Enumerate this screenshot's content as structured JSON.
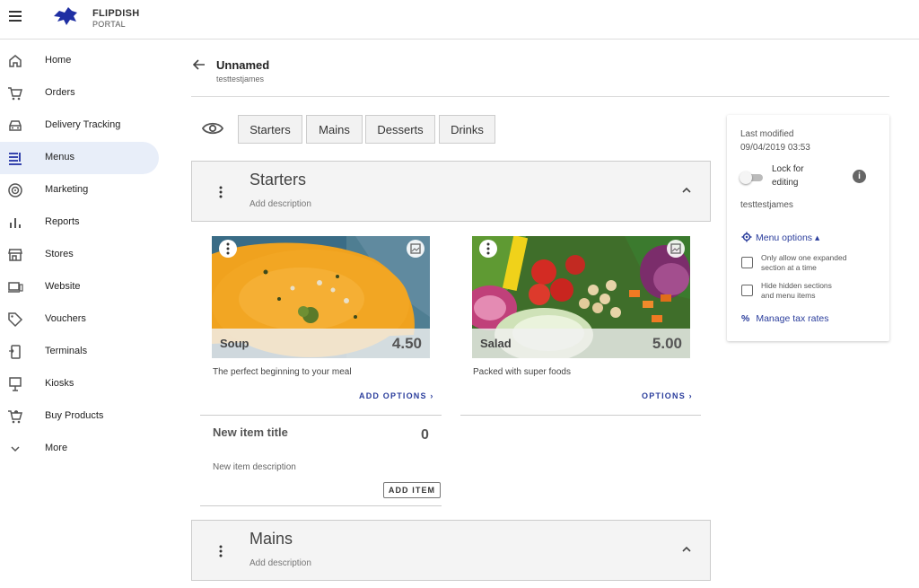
{
  "header": {
    "brand": "FLIPDISH",
    "brand_sub": "PORTAL"
  },
  "sidebar": {
    "items": [
      {
        "label": "Home",
        "icon": "home-icon"
      },
      {
        "label": "Orders",
        "icon": "cart-icon"
      },
      {
        "label": "Delivery Tracking",
        "icon": "car-icon"
      },
      {
        "label": "Menus",
        "icon": "menu-book-icon"
      },
      {
        "label": "Marketing",
        "icon": "target-icon"
      },
      {
        "label": "Reports",
        "icon": "bar-chart-icon"
      },
      {
        "label": "Stores",
        "icon": "store-icon"
      },
      {
        "label": "Website",
        "icon": "laptop-icon"
      },
      {
        "label": "Vouchers",
        "icon": "tag-icon"
      },
      {
        "label": "Terminals",
        "icon": "terminal-icon"
      },
      {
        "label": "Kiosks",
        "icon": "kiosk-icon"
      },
      {
        "label": "Buy Products",
        "icon": "shopping-cart-icon"
      },
      {
        "label": "More",
        "icon": "chevron-down-icon"
      }
    ],
    "active_index": 3
  },
  "page": {
    "title": "Unnamed",
    "subtitle": "testtestjames"
  },
  "tabs": [
    "Starters",
    "Mains",
    "Desserts",
    "Drinks"
  ],
  "sections": [
    {
      "title": "Starters",
      "description": "Add description"
    },
    {
      "title": "Mains",
      "description": "Add description"
    }
  ],
  "items": [
    {
      "name": "Soup",
      "price": "4.50",
      "description": "The perfect beginning to your meal",
      "action": "ADD OPTIONS"
    },
    {
      "name": "Salad",
      "price": "5.00",
      "description": "Packed with super foods",
      "action": "OPTIONS"
    }
  ],
  "new_item": {
    "title": "New item title",
    "price": "0",
    "description": "New item description",
    "button": "ADD ITEM"
  },
  "panel": {
    "last_modified_label": "Last modified",
    "last_modified_value": "09/04/2019 03:53",
    "lock_label_1": "Lock for",
    "lock_label_2": "editing",
    "lock_enabled": false,
    "user": "testtestjames",
    "menu_options_label": "Menu options",
    "option_1_line1": "Only allow one expanded",
    "option_1_line2": "section at a time",
    "option_1_checked": false,
    "option_2_line1": "Hide hidden sections",
    "option_2_line2": "and menu items",
    "option_2_checked": false,
    "tax_link": "Manage tax rates"
  },
  "colors": {
    "accent": "#2a3d9c",
    "active_nav_bg": "#e8eef9",
    "section_bg": "#f4f4f4"
  }
}
